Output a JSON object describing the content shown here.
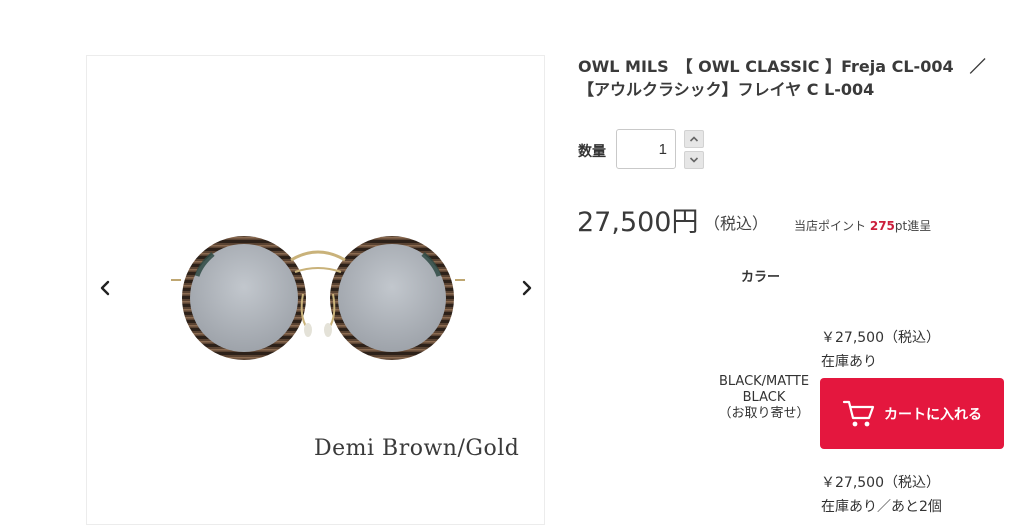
{
  "product": {
    "title": "OWL MILS　【 OWL CLASSIC 】Freja CL-004　／【アウルクラシック】フレイヤ C L-004",
    "image_caption": "Demi Brown/Gold"
  },
  "gallery": {
    "prev_icon": "chevron-left-icon",
    "next_icon": "chevron-right-icon"
  },
  "quantity": {
    "label": "数量",
    "value": "1"
  },
  "pricing": {
    "price": "27,500円",
    "tax_note": "（税込）",
    "points_prefix": "当店ポイント",
    "points_value": "275",
    "points_suffix": "pt進呈"
  },
  "color_section": {
    "header": "カラー"
  },
  "variants": [
    {
      "price": "￥27,500（税込）",
      "stock": "在庫あり",
      "name_line1": "BLACK/MATTE",
      "name_line2": "BLACK",
      "name_line3": "（お取り寄せ）",
      "button_label": "カートに入れる"
    },
    {
      "price": "￥27,500（税込）",
      "stock": "在庫あり／あと2個"
    }
  ],
  "colors": {
    "accent": "#e4173e",
    "points_highlight": "#cc1f3c",
    "text": "#333333"
  }
}
